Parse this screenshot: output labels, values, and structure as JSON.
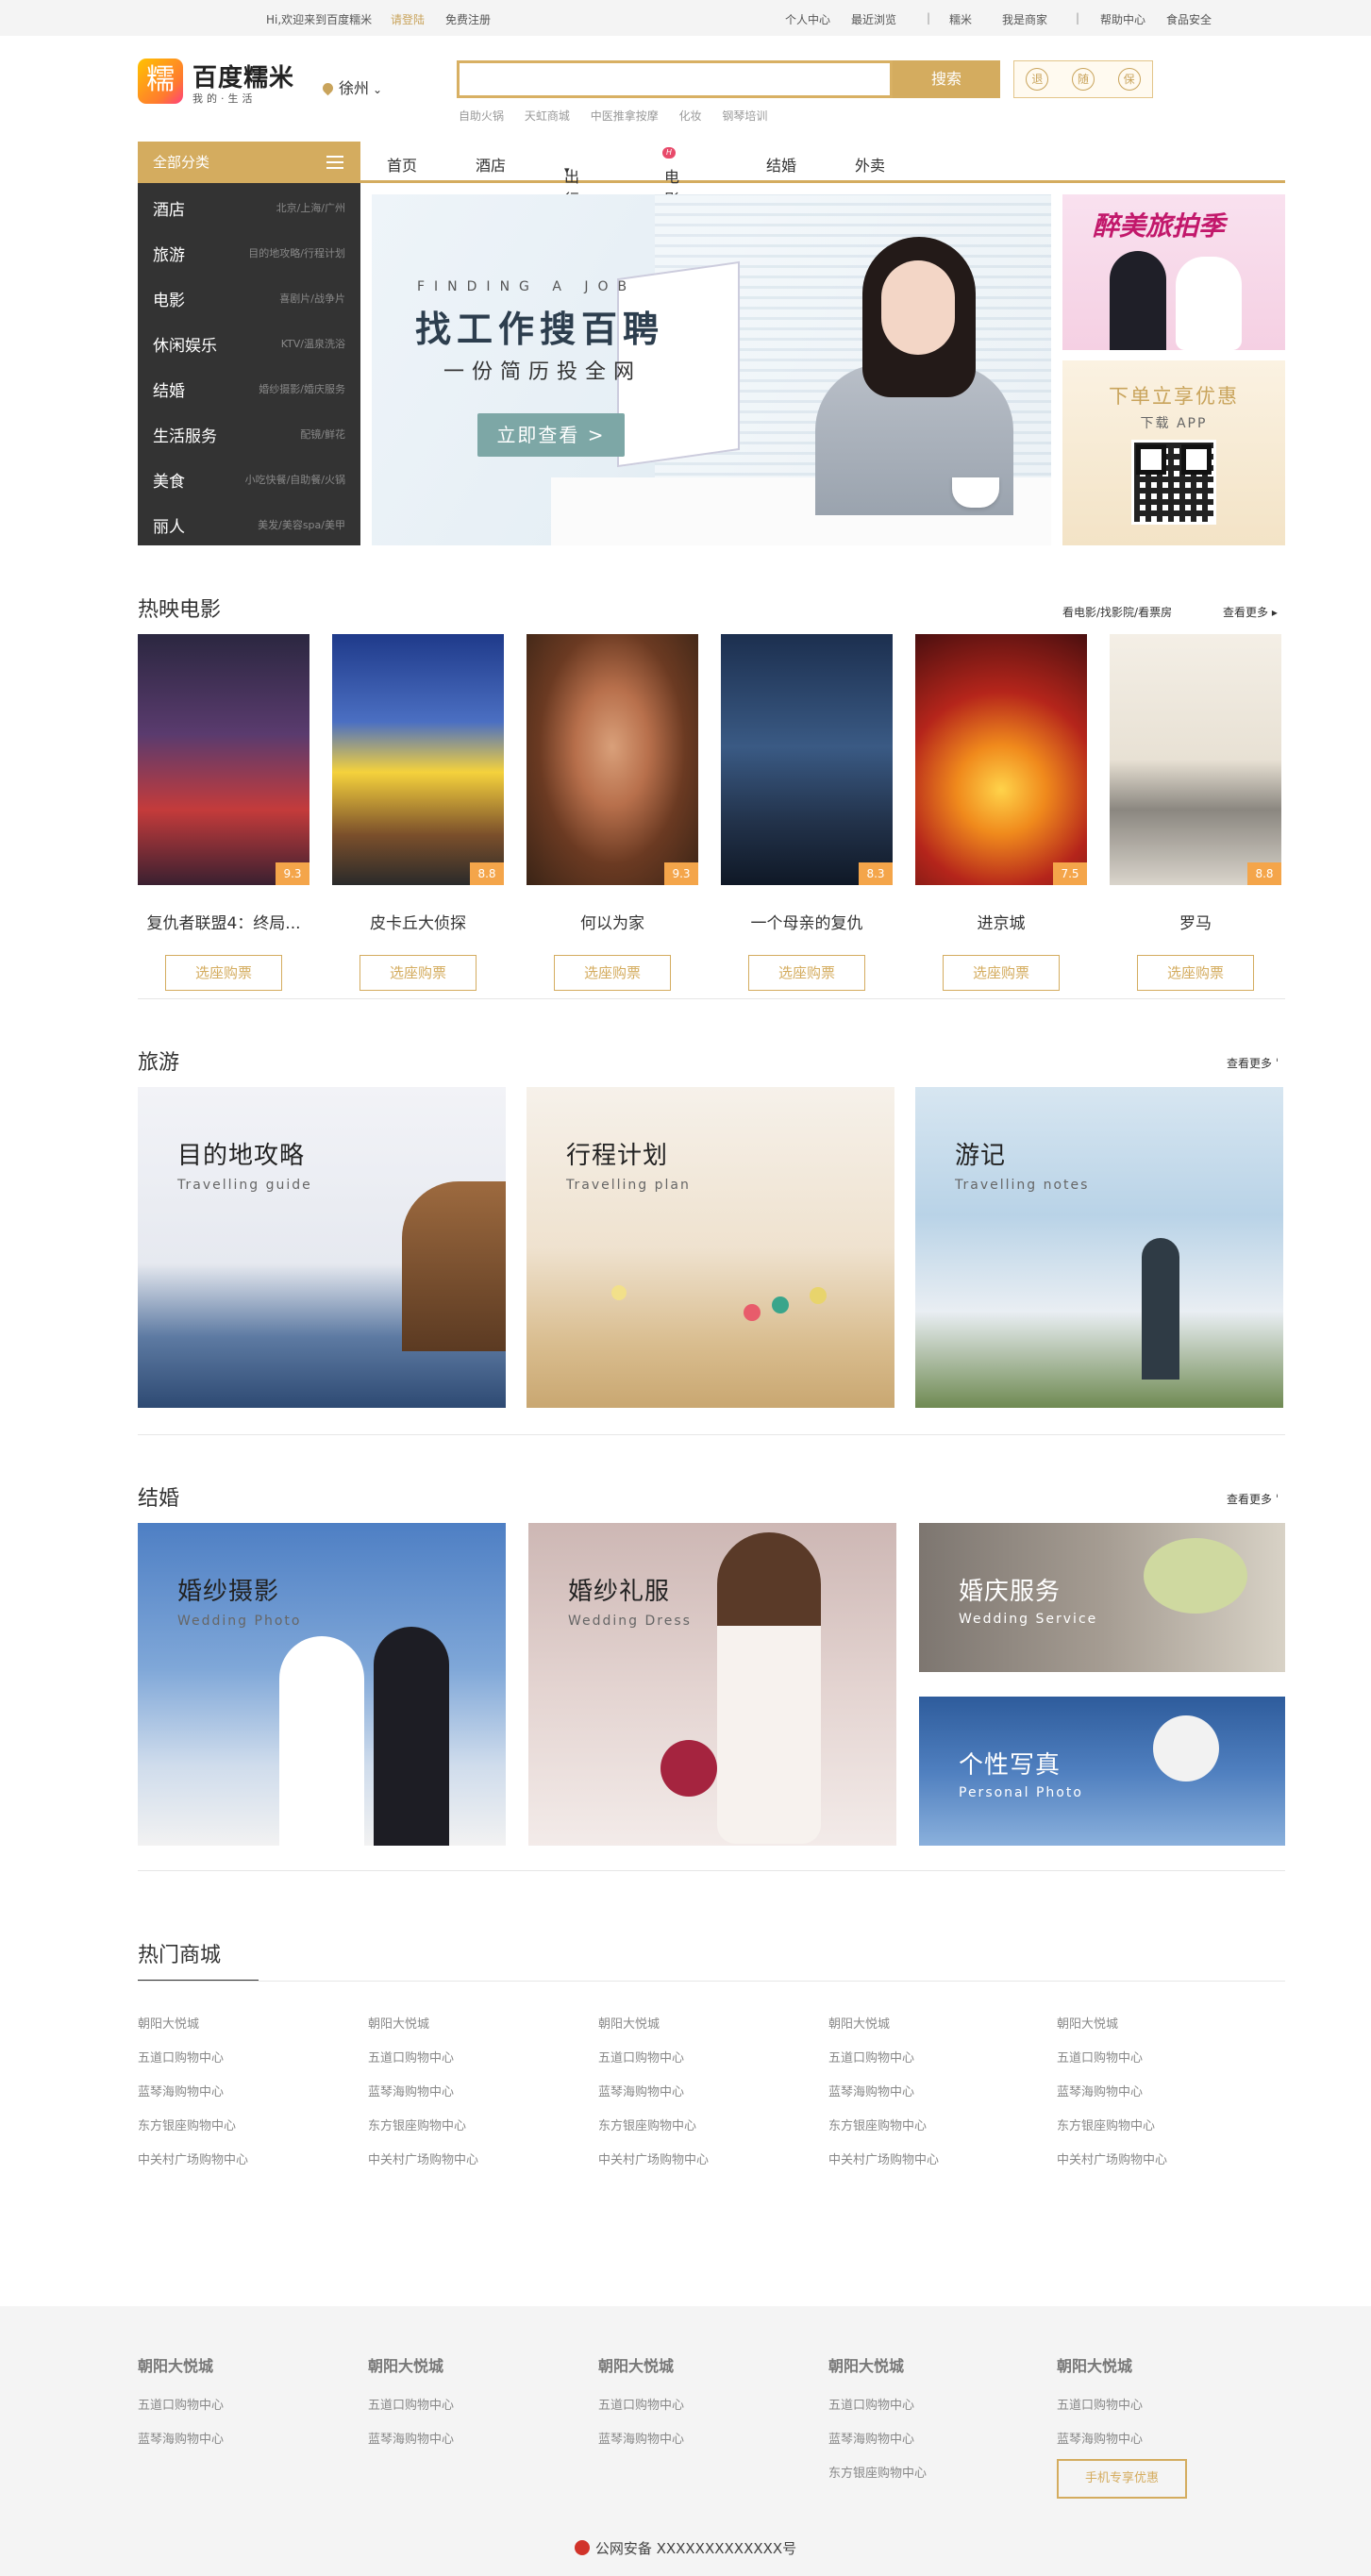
{
  "topbar": {
    "welcome": "Hi,欢迎来到百度糯米",
    "login": "请登陆",
    "register": "免费注册",
    "personal": "个人中心",
    "recent": "最近浏览",
    "nuomi": "糯米",
    "merchant": "我是商家",
    "help": "帮助中心",
    "food_safety": "食品安全",
    "sep": "|"
  },
  "header": {
    "logo_char": "糯",
    "brand": "百度糯米",
    "brand_sub": "我的·生活",
    "city": "徐州",
    "search_placeholder": "",
    "search_button": "搜索",
    "hot_words": [
      "自助火锅",
      "天虹商城",
      "中医推拿按摩",
      "化妆",
      "钢琴培训"
    ],
    "badges": [
      "退",
      "随",
      "保"
    ]
  },
  "nav": {
    "all_categories": "全部分类",
    "items": [
      "首页",
      "酒店",
      "出行",
      "电影",
      "结婚",
      "外卖"
    ],
    "dropdown_mark": "▾",
    "hot_badge": "H"
  },
  "categories": [
    {
      "name": "酒店",
      "desc": "北京/上海/广州"
    },
    {
      "name": "旅游",
      "desc": "目的地攻略/行程计划"
    },
    {
      "name": "电影",
      "desc": "喜剧片/战争片"
    },
    {
      "name": "休闲娱乐",
      "desc": "KTV/温泉洗浴"
    },
    {
      "name": "结婚",
      "desc": "婚纱摄影/婚庆服务"
    },
    {
      "name": "生活服务",
      "desc": "配镜/鲜花"
    },
    {
      "name": "美食",
      "desc": "小吃快餐/自助餐/火锅"
    },
    {
      "name": "丽人",
      "desc": "美发/美容spa/美甲"
    }
  ],
  "banner": {
    "en": "FINDING A JOB",
    "title": "找工作搜百聘",
    "sub": "一份简历投全网",
    "button": "立即查看 >"
  },
  "side_ads": {
    "ad1_title": "醉美旅拍季",
    "ad2_title": "下单立享优惠",
    "ad2_sub": "下载 APP"
  },
  "movies": {
    "title": "热映电影",
    "links": "看电影/找影院/看票房",
    "more": "查看更多",
    "buy_label": "选座购票",
    "items": [
      {
        "name": "复仇者联盟4：终局...",
        "score": "9.3"
      },
      {
        "name": "皮卡丘大侦探",
        "score": "8.8"
      },
      {
        "name": "何以为家",
        "score": "9.3"
      },
      {
        "name": "一个母亲的复仇",
        "score": "8.3"
      },
      {
        "name": "进京城",
        "score": "7.5"
      },
      {
        "name": "罗马",
        "score": "8.8"
      }
    ]
  },
  "travel": {
    "title": "旅游",
    "more": "查看更多",
    "items": [
      {
        "title": "目的地攻略",
        "en": "Travelling guide"
      },
      {
        "title": "行程计划",
        "en": "Travelling plan"
      },
      {
        "title": "游记",
        "en": "Travelling notes"
      }
    ]
  },
  "wedding": {
    "title": "结婚",
    "more": "查看更多",
    "items": [
      {
        "title": "婚纱摄影",
        "en": "Wedding Photo"
      },
      {
        "title": "婚纱礼服",
        "en": "Wedding Dress"
      },
      {
        "title": "婚庆服务",
        "en": "Wedding Service"
      },
      {
        "title": "个性写真",
        "en": "Personal Photo"
      }
    ]
  },
  "mall": {
    "title": "热门商城",
    "columns": [
      [
        "朝阳大悦城",
        "五道口购物中心",
        "蓝琴海购物中心",
        "东方银座购物中心",
        "中关村广场购物中心"
      ],
      [
        "朝阳大悦城",
        "五道口购物中心",
        "蓝琴海购物中心",
        "东方银座购物中心",
        "中关村广场购物中心"
      ],
      [
        "朝阳大悦城",
        "五道口购物中心",
        "蓝琴海购物中心",
        "东方银座购物中心",
        "中关村广场购物中心"
      ],
      [
        "朝阳大悦城",
        "五道口购物中心",
        "蓝琴海购物中心",
        "东方银座购物中心",
        "中关村广场购物中心"
      ],
      [
        "朝阳大悦城",
        "五道口购物中心",
        "蓝琴海购物中心",
        "东方银座购物中心",
        "中关村广场购物中心"
      ]
    ]
  },
  "footer": {
    "columns": [
      {
        "head": "朝阳大悦城",
        "items": [
          "五道口购物中心",
          "蓝琴海购物中心"
        ]
      },
      {
        "head": "朝阳大悦城",
        "items": [
          "五道口购物中心",
          "蓝琴海购物中心"
        ]
      },
      {
        "head": "朝阳大悦城",
        "items": [
          "五道口购物中心",
          "蓝琴海购物中心"
        ]
      },
      {
        "head": "朝阳大悦城",
        "items": [
          "五道口购物中心",
          "蓝琴海购物中心",
          "东方银座购物中心"
        ]
      },
      {
        "head": "朝阳大悦城",
        "items": [
          "五道口购物中心",
          "蓝琴海购物中心"
        ]
      }
    ],
    "mobile_button": "手机专享优惠",
    "icp": "公网安备 XXXXXXXXXXXXX号"
  },
  "colors": {
    "accent": "#d4ac5f",
    "dark_menu": "#333333",
    "score": "#f4a54a"
  }
}
